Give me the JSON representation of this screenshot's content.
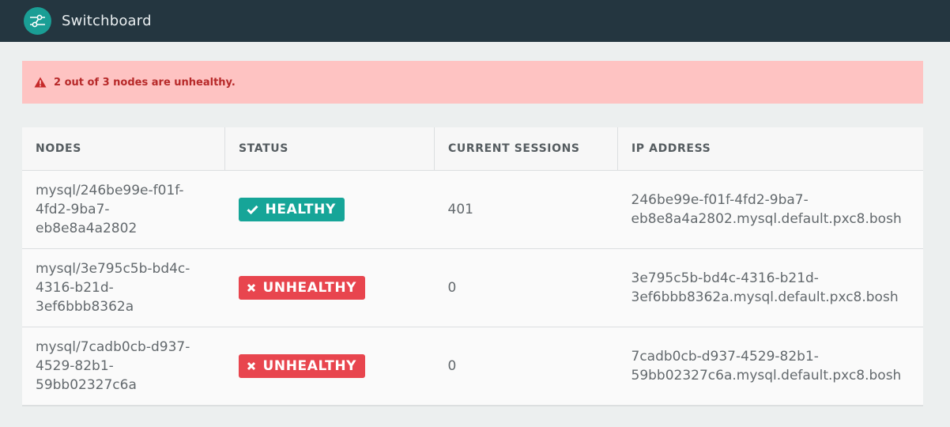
{
  "header": {
    "app_title": "Switchboard",
    "logo_icon": "switchboard-logo-icon"
  },
  "alert": {
    "icon": "warning-triangle-icon",
    "message": "2 out of 3 nodes are unhealthy."
  },
  "table": {
    "columns": [
      "NODES",
      "STATUS",
      "CURRENT SESSIONS",
      "IP ADDRESS"
    ],
    "rows": [
      {
        "node": "mysql/246be99e-f01f-4fd2-9ba7-eb8e8a4a2802",
        "status": "HEALTHY",
        "status_icon": "check-icon",
        "sessions": "401",
        "ip": "246be99e-f01f-4fd2-9ba7-eb8e8a4a2802.mysql.default.pxc8.bosh"
      },
      {
        "node": "mysql/3e795c5b-bd4c-4316-b21d-3ef6bbb8362a",
        "status": "UNHEALTHY",
        "status_icon": "x-icon",
        "sessions": "0",
        "ip": "3e795c5b-bd4c-4316-b21d-3ef6bbb8362a.mysql.default.pxc8.bosh"
      },
      {
        "node": "mysql/7cadb0cb-d937-4529-82b1-59bb02327c6a",
        "status": "UNHEALTHY",
        "status_icon": "x-icon",
        "sessions": "0",
        "ip": "7cadb0cb-d937-4529-82b1-59bb02327c6a.mysql.default.pxc8.bosh"
      }
    ]
  },
  "colors": {
    "topbar": "#243640",
    "accent": "#1a9e95",
    "healthy": "#16a598",
    "unhealthy": "#e8454e",
    "alert_bg": "#fec3c2",
    "alert_text": "#b72929"
  }
}
